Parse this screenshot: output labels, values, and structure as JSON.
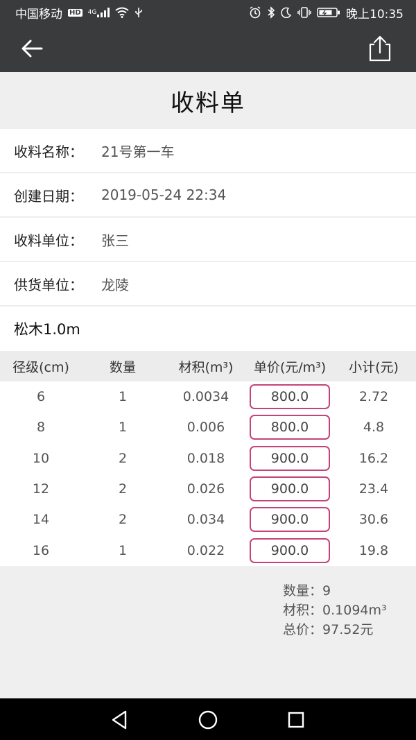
{
  "status_bar": {
    "carrier": "中国移动",
    "network_badge": "HD",
    "network_type": "4G",
    "time": "晚上10:35",
    "icons": [
      "signal-icon",
      "wifi-icon",
      "usb-icon",
      "alarm-icon",
      "bluetooth-icon",
      "moon-icon",
      "vibrate-icon",
      "battery-icon"
    ]
  },
  "app_bar": {
    "back_icon": "arrow-left-icon",
    "share_icon": "share-icon"
  },
  "page": {
    "title": "收料单"
  },
  "info": [
    {
      "label": "收料名称：",
      "value": "21号第一车"
    },
    {
      "label": "创建日期：",
      "value": "2019-05-24 22:34"
    },
    {
      "label": "收料单位：",
      "value": "张三"
    },
    {
      "label": "供货单位：",
      "value": "龙陵"
    }
  ],
  "section": {
    "title": "松木1.0m"
  },
  "table": {
    "headers": [
      "径级(cm)",
      "数量",
      "材积(m³)",
      "单价(元/m³)",
      "小计(元)"
    ],
    "rows": [
      {
        "diameter": "6",
        "quantity": "1",
        "volume": "0.0034",
        "unit_price": "800.0",
        "subtotal": "2.72"
      },
      {
        "diameter": "8",
        "quantity": "1",
        "volume": "0.006",
        "unit_price": "800.0",
        "subtotal": "4.8"
      },
      {
        "diameter": "10",
        "quantity": "2",
        "volume": "0.018",
        "unit_price": "900.0",
        "subtotal": "16.2"
      },
      {
        "diameter": "12",
        "quantity": "2",
        "volume": "0.026",
        "unit_price": "900.0",
        "subtotal": "23.4"
      },
      {
        "diameter": "14",
        "quantity": "2",
        "volume": "0.034",
        "unit_price": "900.0",
        "subtotal": "30.6"
      },
      {
        "diameter": "16",
        "quantity": "1",
        "volume": "0.022",
        "unit_price": "900.0",
        "subtotal": "19.8"
      }
    ]
  },
  "summary": {
    "quantity_label": "数量：",
    "quantity_value": "9",
    "volume_label": "材积：",
    "volume_value": "0.1094m³",
    "total_label": "总价：",
    "total_value": "97.52元"
  },
  "colors": {
    "app_bar": "#3a3b3d",
    "price_border": "#c4437a",
    "background": "#efefef"
  },
  "nav_bar": {
    "icons": [
      "back-triangle-icon",
      "home-circle-icon",
      "recents-square-icon"
    ]
  }
}
